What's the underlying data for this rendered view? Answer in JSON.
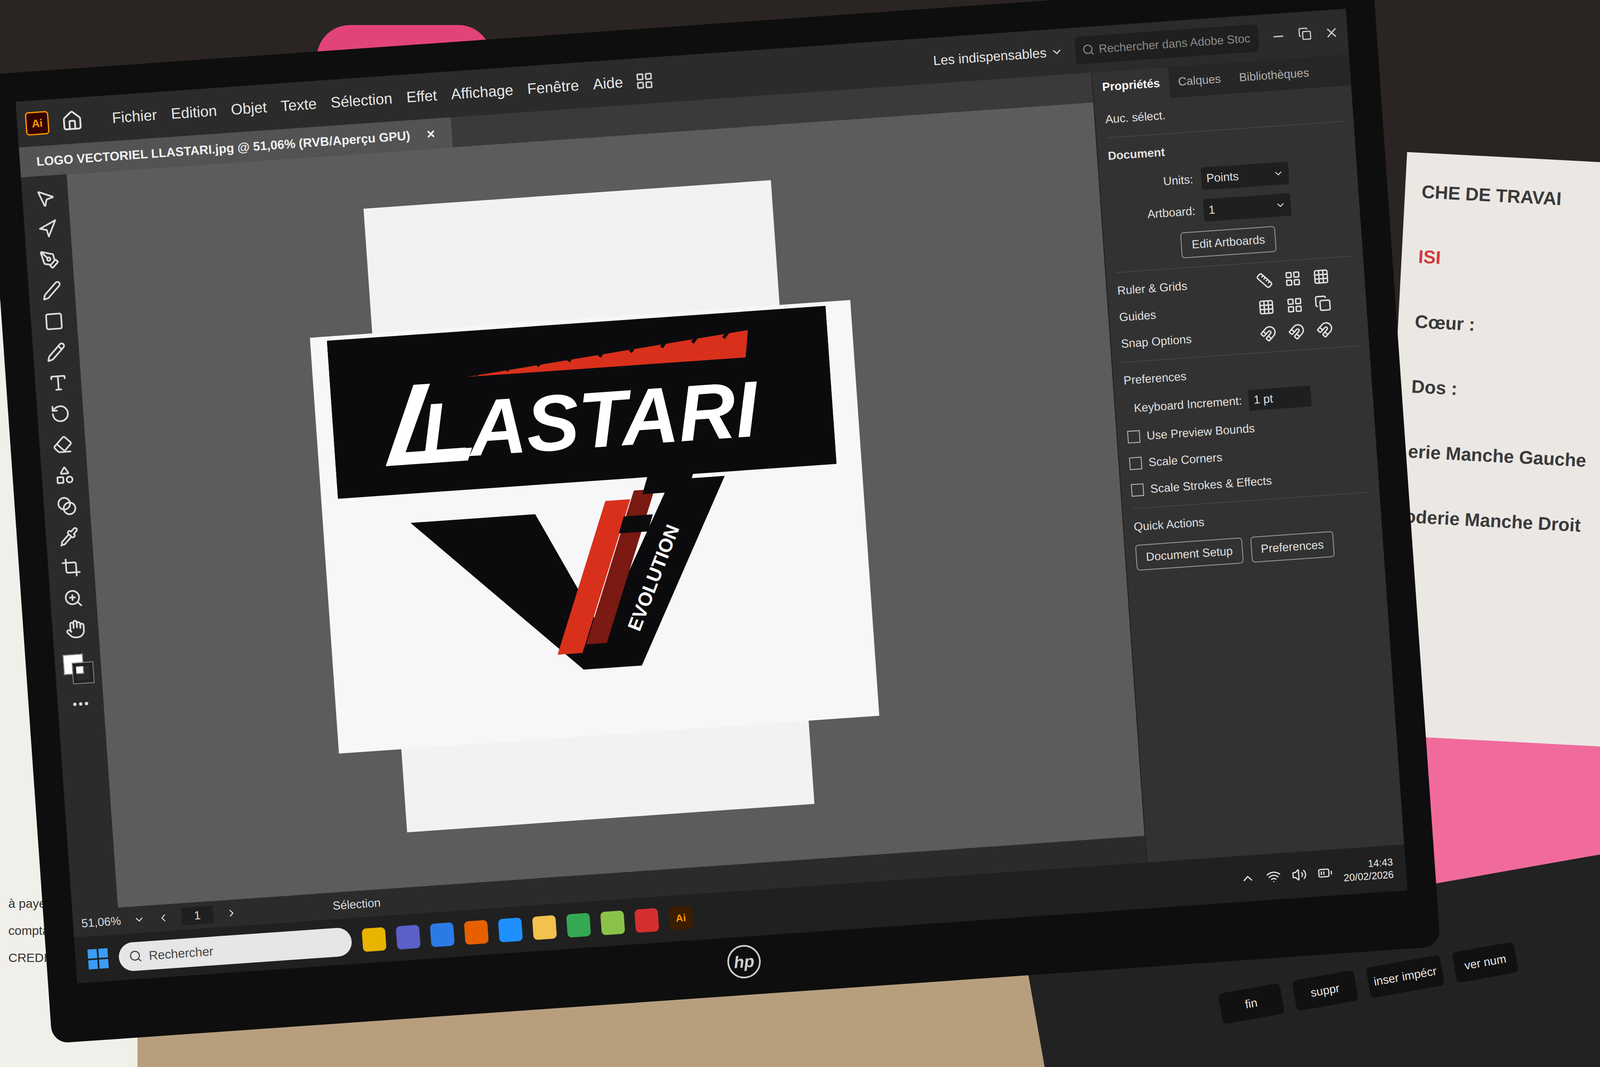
{
  "menu": [
    "Fichier",
    "Edition",
    "Objet",
    "Texte",
    "Sélection",
    "Effet",
    "Affichage",
    "Fenêtre",
    "Aide"
  ],
  "app_badge": "Ai",
  "workspace": "Les indispensables",
  "search": {
    "placeholder": "Rechercher dans Adobe Stoc"
  },
  "document_tab": {
    "title": "LOGO VECTORIEL LLASTARI.jpg @ 51,06% (RVB/Aperçu GPU)",
    "close": "×"
  },
  "panel": {
    "tabs": [
      {
        "label": "Propriétés",
        "selected": true
      },
      {
        "label": "Calques",
        "selected": false
      },
      {
        "label": "Bibliothèques",
        "selected": false
      }
    ],
    "no_selection": "Auc. sélect.",
    "document_heading": "Document",
    "units_label": "Units:",
    "units_value": "Points",
    "artboard_label": "Artboard:",
    "artboard_value": "1",
    "edit_artboards": "Edit Artboards",
    "sections": [
      "Ruler & Grids",
      "Guides",
      "Snap Options"
    ],
    "preferences_heading": "Preferences",
    "keyboard_increment_label": "Keyboard Increment:",
    "keyboard_increment_value": "1 pt",
    "checkboxes": [
      {
        "label": "Use Preview Bounds",
        "checked": false
      },
      {
        "label": "Scale Corners",
        "checked": false
      },
      {
        "label": "Scale Strokes & Effects",
        "checked": false
      }
    ],
    "quick_actions": "Quick Actions",
    "buttons": [
      "Document Setup",
      "Preferences"
    ]
  },
  "artwork": {
    "brand": "LASTARI",
    "tagline": "EVOLUTION"
  },
  "status_bar": {
    "zoom": "51,06%",
    "artboard": "1",
    "tool": "Sélection"
  },
  "taskbar": {
    "search_placeholder": "Rechercher",
    "time": "14:43",
    "date": "20/02/2026"
  },
  "laptop_brand": "hp",
  "keyboard": {
    "keys": [
      "fin",
      "suppr",
      "inser impécr",
      "ver num"
    ]
  },
  "papers": {
    "left": [
      "à payer le",
      "comptant)",
      "CREDIT AGRICOL"
    ],
    "right": [
      {
        "text": "CHE DE TRAVAI",
        "color": "#3a3a3a"
      },
      {
        "text": "ISI",
        "color": "#d23a3a"
      },
      {
        "text": "Cœur :",
        "color": "#3a3a3a"
      },
      {
        "text": "Dos :",
        "color": "#3a3a3a"
      },
      {
        "text": "erie Manche Gauche",
        "color": "#3a3a3a"
      },
      {
        "text": "oderie Manche Droit",
        "color": "#3a3a3a"
      }
    ]
  }
}
